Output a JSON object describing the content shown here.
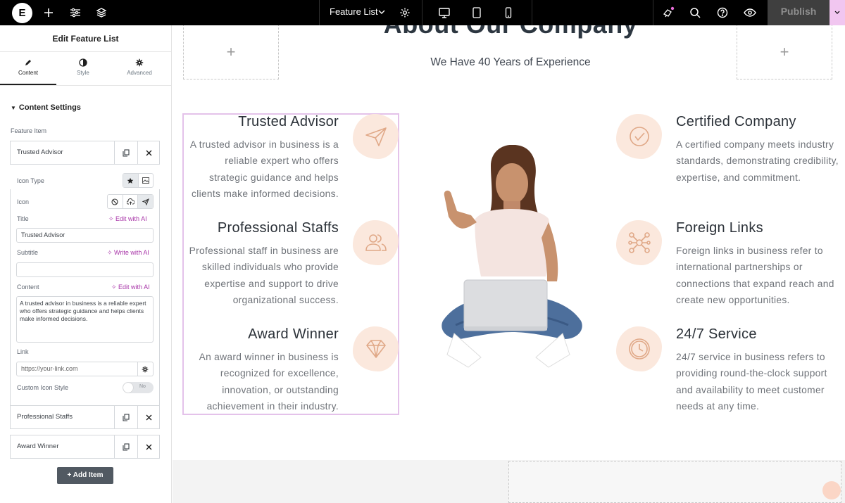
{
  "topbar": {
    "logo": "E",
    "doc_name": "Feature List",
    "publish_label": "Publish",
    "icons": [
      "add-icon",
      "sliders-icon",
      "layers-icon",
      "chevron-down-icon",
      "settings-icon",
      "desktop-icon",
      "tablet-icon",
      "mobile-icon",
      "notification-icon",
      "search-icon",
      "help-icon",
      "preview-eye-icon",
      "caret-down-icon"
    ]
  },
  "panel": {
    "title": "Edit Feature List",
    "tabs": [
      {
        "label": "Content",
        "icon": "pencil-icon"
      },
      {
        "label": "Style",
        "icon": "half-circle-icon"
      },
      {
        "label": "Advanced",
        "icon": "gear-icon"
      }
    ],
    "section_title": "Content Settings",
    "repeater_label": "Feature Item",
    "items": [
      "Trusted Advisor",
      "Professional Staffs",
      "Award Winner"
    ],
    "fields": {
      "icon_type_label": "Icon Type",
      "icon_label": "Icon",
      "title_label": "Title",
      "title_value": "Trusted Advisor",
      "subtitle_label": "Subtitle",
      "subtitle_value": "",
      "content_label": "Content",
      "content_value": "A trusted advisor in business is a reliable expert who offers strategic guidance and helps clients make informed decisions.",
      "link_label": "Link",
      "link_placeholder": "https://your-link.com",
      "custom_icon_label": "Custom Icon Style",
      "toggle_value": "No",
      "edit_ai": "Edit with AI",
      "write_ai": "Write with AI"
    },
    "add_item_label": "Add Item"
  },
  "canvas": {
    "heading": "About Our Company",
    "subheading": "We Have 40 Years of Experience",
    "left_features": [
      {
        "title": "Trusted Advisor",
        "body": "A trusted advisor in business is a reliable expert who offers strategic guidance and helps clients make informed decisions.",
        "icon": "paper-plane-icon"
      },
      {
        "title": "Professional Staffs",
        "body": "Professional staff in business are skilled individuals who provide expertise and support to drive organizational success.",
        "icon": "users-icon"
      },
      {
        "title": "Award Winner",
        "body": "An award winner in business is recognized for excellence, innovation, or outstanding achievement in their industry.",
        "icon": "diamond-icon"
      }
    ],
    "right_features": [
      {
        "title": "Certified Company",
        "body": "A certified company meets industry standards, demonstrating credibility, expertise, and commitment.",
        "icon": "check-circle-icon"
      },
      {
        "title": "Foreign Links",
        "body": "Foreign links in business refer to international partnerships or connections that expand reach and create new opportunities.",
        "icon": "network-icon"
      },
      {
        "title": "24/7 Service",
        "body": "24/7 service in business refers to providing round-the-clock support and availability to meet customer needs at any time.",
        "icon": "clock-icon"
      }
    ]
  },
  "colors": {
    "accent": "#a835a8",
    "blob": "#fbe8dd",
    "icon_stroke": "#e0a887",
    "selection": "#e4c2ea"
  }
}
